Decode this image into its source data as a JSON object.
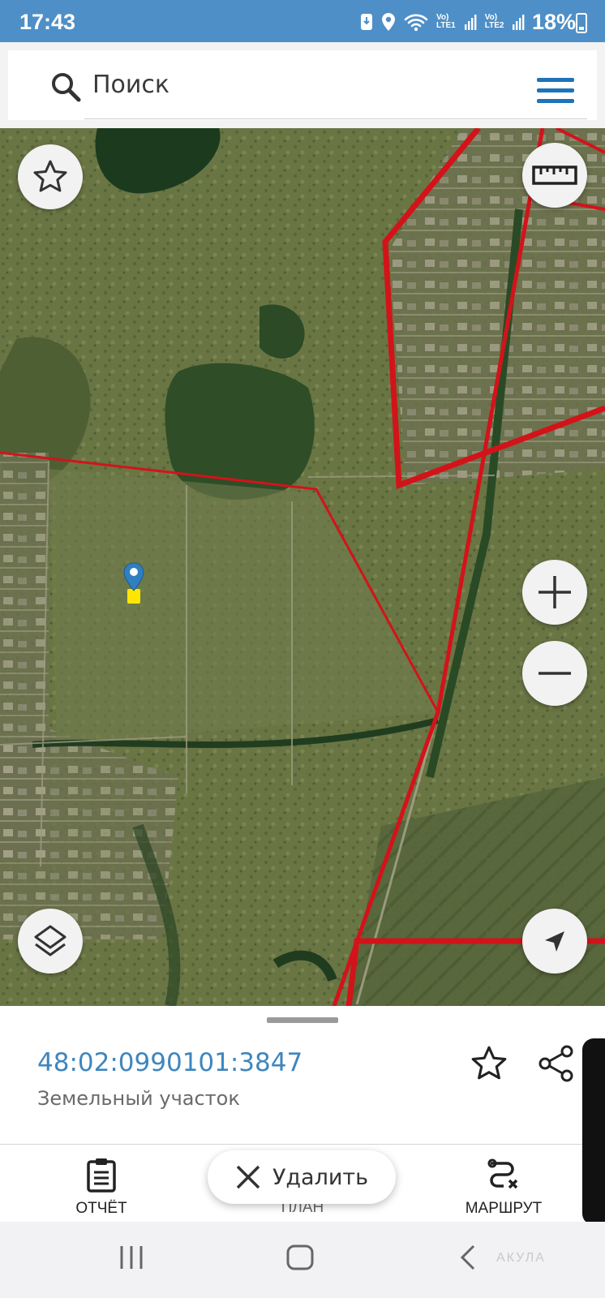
{
  "status_bar": {
    "time": "17:43",
    "sim1": [
      "Vo)",
      "LTE1"
    ],
    "sim2": [
      "Vo)",
      "LTE2"
    ],
    "battery": "18%",
    "icons": [
      "sim-save-icon",
      "location-icon",
      "wifi-icon",
      "signal-icon",
      "battery-icon"
    ]
  },
  "search": {
    "placeholder": "Поиск",
    "icon": "search-icon",
    "menu_icon": "hamburger-menu-icon"
  },
  "map": {
    "controls": [
      "favorite-star-icon",
      "ruler-icon",
      "zoom-in-icon",
      "zoom-out-icon",
      "layers-icon",
      "my-location-icon"
    ],
    "parcel_line_color": "#d3131a",
    "marker_color": "#2f7fc1",
    "marker_flag_color": "#ffe600"
  },
  "parcel": {
    "cadastral_number": "48:02:0990101:3847",
    "type": "Земельный участок"
  },
  "actions": {
    "report": "ОТЧЁТ",
    "plan": "ПЛАН",
    "delete": "Удалить",
    "route": "МАРШРУТ"
  },
  "navigation": {
    "watermark": "АКУЛА"
  },
  "colors": {
    "status_bar": "#4f8fc7",
    "accent": "#1f73b7",
    "link_text": "#3f86bd"
  }
}
